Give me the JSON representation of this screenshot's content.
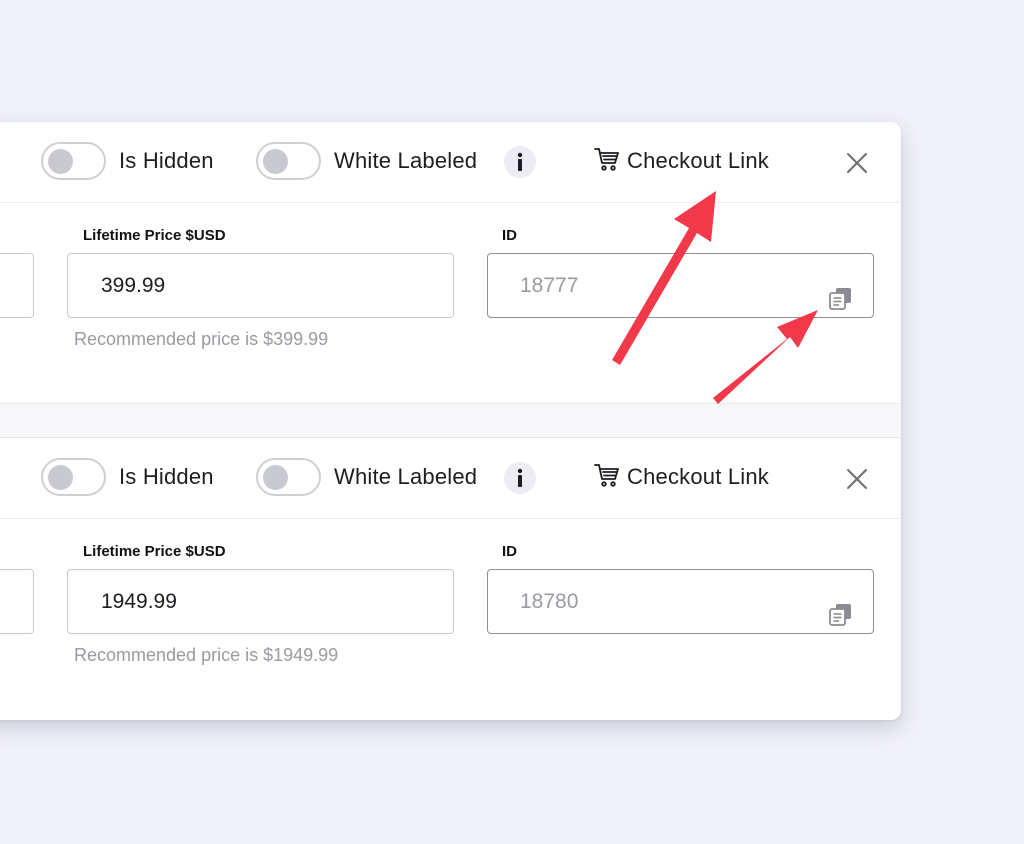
{
  "cards": [
    {
      "is_hidden_label": "Is Hidden",
      "white_labeled_label": "White Labeled",
      "checkout_link_label": "Checkout Link",
      "price_label": "Lifetime Price $USD",
      "price_value": "399.99",
      "price_hint": "Recommended price is $399.99",
      "id_label": "ID",
      "id_value": "18777"
    },
    {
      "is_hidden_label": "Is Hidden",
      "white_labeled_label": "White Labeled",
      "checkout_link_label": "Checkout Link",
      "price_label": "Lifetime Price $USD",
      "price_value": "1949.99",
      "price_hint": "Recommended price is $1949.99",
      "id_label": "ID",
      "id_value": "18780"
    }
  ],
  "colors": {
    "annotation_arrow": "#f2394a",
    "toggle_off": "#c9c9d2"
  },
  "icons": {
    "cart": "cart-icon",
    "info": "info-icon",
    "close": "close-icon",
    "copy": "copy-icon"
  }
}
